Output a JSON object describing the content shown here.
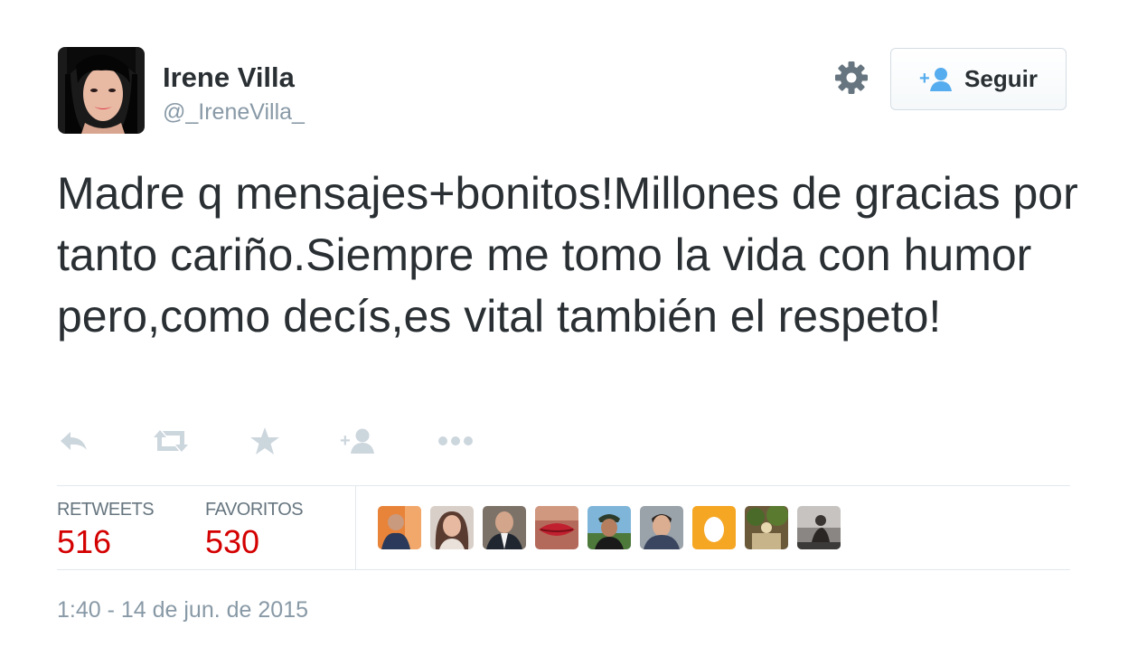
{
  "user": {
    "name": "Irene Villa",
    "handle": "@_IreneVilla_"
  },
  "header": {
    "settings_icon": "gear-icon",
    "follow_icon": "add-user-icon",
    "follow_label": "Seguir"
  },
  "tweet": {
    "text": "Madre q mensajes+bonitos!Millones de gracias por tanto cariño.Siempre me tomo la vida con humor pero,como decís,es vital también el respeto!"
  },
  "actions": [
    {
      "icon": "reply-icon"
    },
    {
      "icon": "retweet-icon"
    },
    {
      "icon": "star-icon"
    },
    {
      "icon": "follow-icon"
    },
    {
      "icon": "more-icon"
    }
  ],
  "stats": {
    "retweets_label": "RETWEETS",
    "retweets_count": "516",
    "favorites_label": "FAVORITOS",
    "favorites_count": "530"
  },
  "colors": {
    "accent": "#55acee",
    "count": "#d40000",
    "text": "#292f33",
    "muted": "#8899a6"
  },
  "timestamp": "1:40 - 14 de jun. de 2015"
}
